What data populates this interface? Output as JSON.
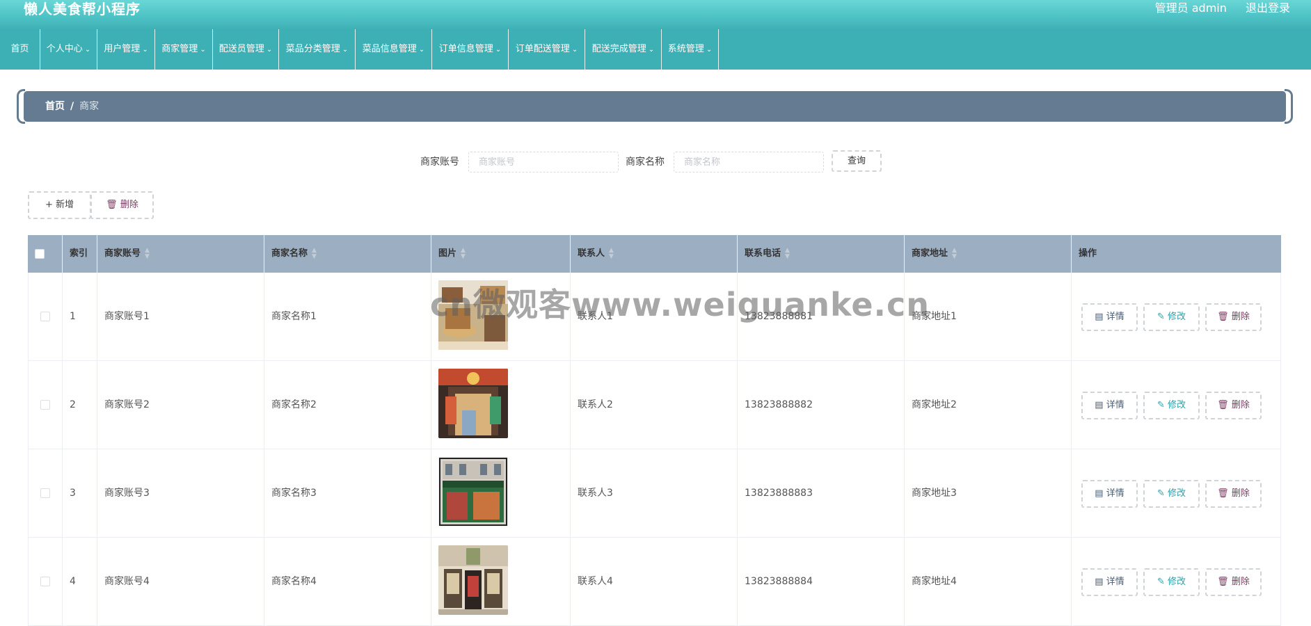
{
  "header": {
    "app_title": "懒人美食帮小程序",
    "user_label": "管理员 admin",
    "logout_label": "退出登录"
  },
  "nav": {
    "home": "首页",
    "items": [
      "个人中心",
      "用户管理",
      "商家管理",
      "配送员管理",
      "菜品分类管理",
      "菜品信息管理",
      "订单信息管理",
      "订单配送管理",
      "配送完成管理",
      "系统管理"
    ]
  },
  "breadcrumb": {
    "home": "首页",
    "separator": "/",
    "current": "商家"
  },
  "search": {
    "account_label": "商家账号",
    "account_placeholder": "商家账号",
    "account_value": "",
    "name_label": "商家名称",
    "name_placeholder": "商家名称",
    "name_value": "",
    "query_button": "查询"
  },
  "actions": {
    "add": "新增",
    "delete": "删除"
  },
  "table": {
    "columns": {
      "index": "索引",
      "account": "商家账号",
      "name": "商家名称",
      "image": "图片",
      "contact": "联系人",
      "phone": "联系电话",
      "address": "商家地址",
      "ops": "操作"
    },
    "ops_labels": {
      "detail": "详情",
      "edit": "修改",
      "delete": "删除"
    },
    "rows": [
      {
        "index": "1",
        "account": "商家账号1",
        "name": "商家名称1",
        "contact": "联系人1",
        "phone": "13823888881",
        "address": "商家地址1"
      },
      {
        "index": "2",
        "account": "商家账号2",
        "name": "商家名称2",
        "contact": "联系人2",
        "phone": "13823888882",
        "address": "商家地址2"
      },
      {
        "index": "3",
        "account": "商家账号3",
        "name": "商家名称3",
        "contact": "联系人3",
        "phone": "13823888883",
        "address": "商家地址3"
      },
      {
        "index": "4",
        "account": "商家账号4",
        "name": "商家名称4",
        "contact": "联系人4",
        "phone": "13823888884",
        "address": "商家地址4"
      }
    ]
  },
  "watermark": "cn微观客www.weiguanke.cn",
  "colors": {
    "topbar": "#4ec3c6",
    "navbar": "#3db0b6",
    "breadcrumb": "#647b91",
    "table_header": "#9caec2",
    "edit": "#2e9fa8",
    "delete": "#7b3d63"
  }
}
